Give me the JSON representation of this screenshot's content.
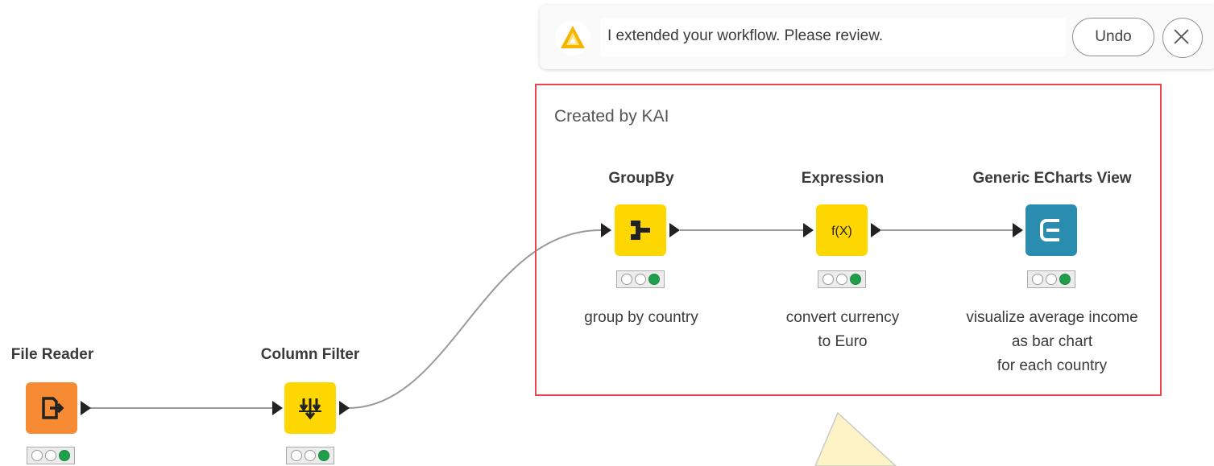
{
  "notification": {
    "message": "I extended your workflow. Please review.",
    "undo_label": "Undo",
    "close_icon": "close-icon",
    "logo_icon": "kai-logo-icon"
  },
  "annotation": {
    "label": "Created by KAI",
    "border_color": "#e8474e"
  },
  "nodes": {
    "file_reader": {
      "title": "File Reader",
      "icon": "file-reader-icon",
      "color": "#f78b33",
      "status": [
        "off",
        "off",
        "on"
      ]
    },
    "column_filter": {
      "title": "Column Filter",
      "icon": "column-filter-icon",
      "color": "#ffd700",
      "status": [
        "off",
        "off",
        "on"
      ]
    },
    "groupby": {
      "title": "GroupBy",
      "description": [
        "group by country"
      ],
      "icon": "groupby-icon",
      "color": "#ffd700",
      "status": [
        "off",
        "off",
        "on"
      ]
    },
    "expression": {
      "title": "Expression",
      "description": [
        "convert currency",
        "to Euro"
      ],
      "icon": "expression-icon",
      "icon_text": "f(X)",
      "color": "#ffd700",
      "status": [
        "off",
        "off",
        "on"
      ]
    },
    "echarts": {
      "title": "Generic ECharts View",
      "description": [
        "visualize average income",
        "as bar chart",
        "for each country"
      ],
      "icon": "echarts-view-icon",
      "color": "#2a8db0",
      "status": [
        "off",
        "off",
        "on"
      ]
    }
  }
}
